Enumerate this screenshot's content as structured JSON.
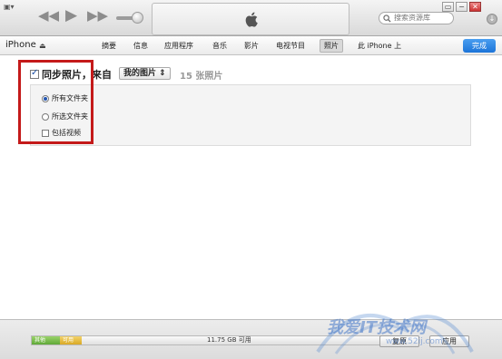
{
  "titlebar": {
    "menu_glyph": "▣▾",
    "prev_glyph": "◀◀",
    "play_glyph": "▶",
    "next_glyph": "▶▶",
    "search_placeholder": "搜索资源库",
    "window_buttons": [
      "▭",
      "−",
      "✕"
    ]
  },
  "navbar": {
    "device_name": "iPhone",
    "tabs": {
      "summary": "摘要",
      "info": "信息",
      "apps": "应用程序",
      "music": "音乐",
      "movies": "影片",
      "tv": "电视节目",
      "photos": "照片",
      "on_device": "此 iPhone 上"
    },
    "done_label": "完成"
  },
  "sync": {
    "label": "同步照片，来自",
    "source_selected": "我的图片 ⇕",
    "count": "15 张照片",
    "checked": true
  },
  "options": {
    "all_folders": "所有文件夹",
    "selected_folders": "所选文件夹",
    "include_videos": "包括视频"
  },
  "footer": {
    "segment_other": "其他",
    "segment_free": "可用",
    "free_space": "11.75 GB 可用",
    "revert_label": "复原",
    "apply_label": "应用"
  },
  "watermark": {
    "title": "我爱IT技术网",
    "url": "www.52ij.com"
  },
  "colors": {
    "accent_blue": "#1c74d8",
    "highlight_red": "#c41a1a",
    "capacity_green": "#5fa838",
    "capacity_yellow": "#d9a925"
  }
}
